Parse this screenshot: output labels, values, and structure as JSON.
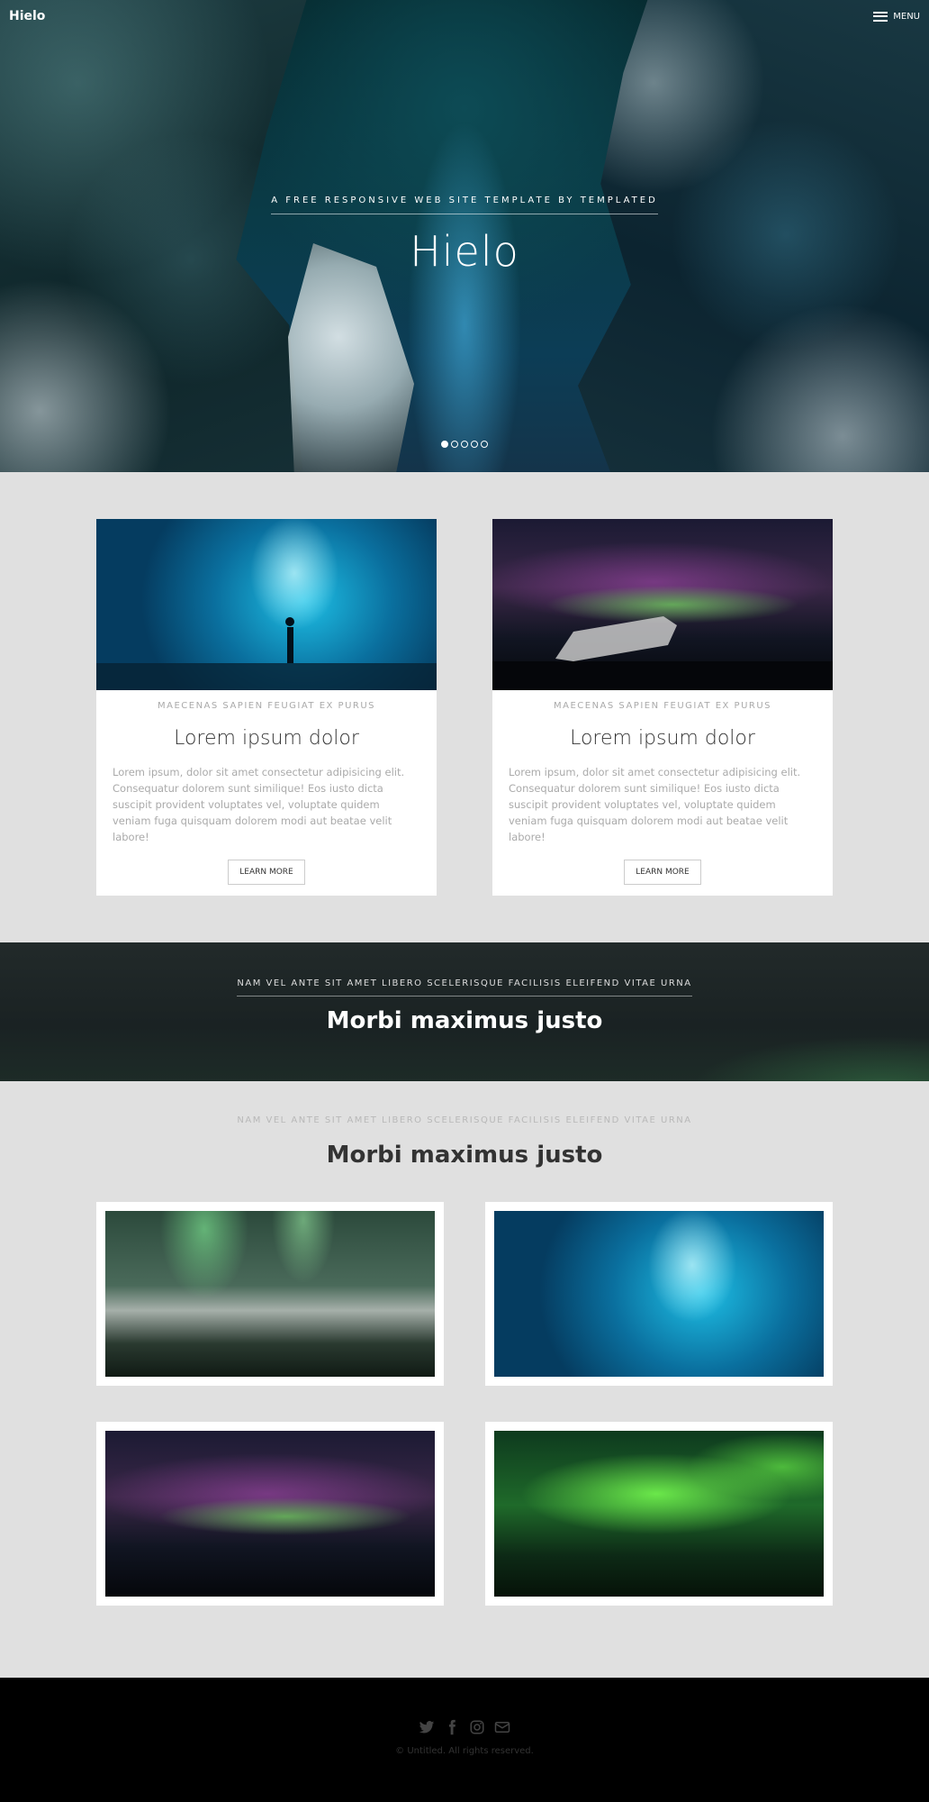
{
  "header": {
    "logo": "Hielo",
    "menu_label": "MENU"
  },
  "hero": {
    "subtitle": "A free responsive web site template by TEMPLATED",
    "title": "Hielo",
    "slides_total": 5,
    "slide_active": 1
  },
  "cards": [
    {
      "category": "maecenas sapien feugiat ex purus",
      "title": "Lorem ipsum dolor",
      "body": "Lorem ipsum, dolor sit amet consectetur adipisicing elit. Consequatur dolorem sunt similique! Eos iusto dicta suscipit provident voluptates vel, voluptate quidem veniam fuga quisquam dolorem modi aut beatae velit labore!",
      "button": "Learn More"
    },
    {
      "category": "maecenas sapien feugiat ex purus",
      "title": "Lorem ipsum dolor",
      "body": "Lorem ipsum, dolor sit amet consectetur adipisicing elit. Consequatur dolorem sunt similique! Eos iusto dicta suscipit provident voluptates vel, voluptate quidem veniam fuga quisquam dolorem modi aut beatae velit labore!",
      "button": "Learn More"
    }
  ],
  "banner": {
    "subtitle": "nam vel ante sit amet libero scelerisque facilisis eleifend vitae urna",
    "title": "Morbi maximus justo"
  },
  "gallery": {
    "subtitle": "nam vel ante sit amet libero scelerisque facilisis eleifend vitae urna",
    "title": "Morbi maximus justo",
    "images": [
      "aurora-landscape",
      "ice-cave",
      "aurora-plane-wreck",
      "green-aurora-lake"
    ]
  },
  "footer": {
    "social": [
      "twitter-icon",
      "facebook-icon",
      "instagram-icon",
      "envelope-icon"
    ],
    "copyright": "© Untitled. All rights reserved."
  }
}
